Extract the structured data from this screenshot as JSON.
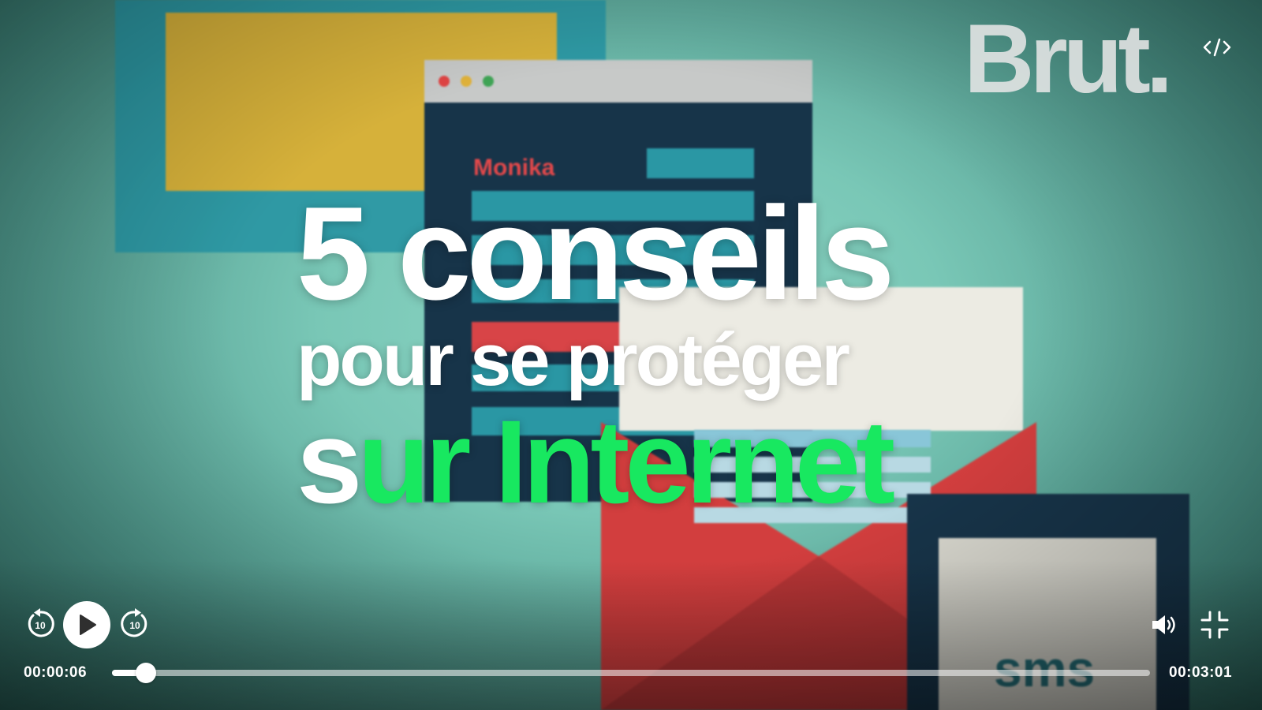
{
  "video": {
    "illustration": {
      "browser_name": "Monika",
      "phone_label": "sms"
    },
    "headline": {
      "line1": "5 conseils",
      "line2": "pour se protéger",
      "line3_white": "s",
      "line3_green": "ur Internet"
    },
    "brand": "Brut."
  },
  "embed_button": {
    "icon": "code-embed-icon"
  },
  "controls": {
    "rewind_seconds": "10",
    "forward_seconds": "10",
    "play_icon": "play-icon",
    "volume_icon": "volume-icon",
    "fullscreen_icon": "exit-fullscreen-icon",
    "current_time": "00:00:06",
    "duration": "00:03:01",
    "progress_fraction": 0.033
  },
  "colors": {
    "accent_green": "#18e860",
    "control_white": "#ffffff"
  }
}
